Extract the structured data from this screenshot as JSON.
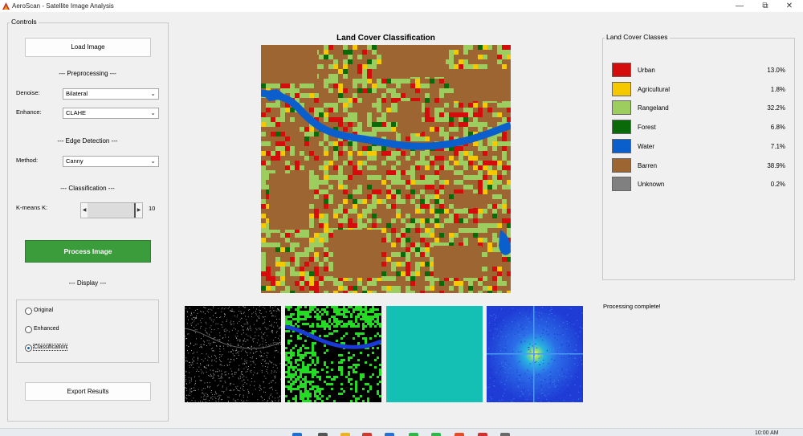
{
  "window": {
    "title": "AeroScan - Satellite Image Analysis",
    "minimize_glyph": "—",
    "maximize_glyph": "⧉",
    "close_glyph": "✕"
  },
  "controls": {
    "title": "Controls",
    "load_label": "Load Image",
    "preprocessing_label": "--- Preprocessing ---",
    "denoise_label": "Denoise:",
    "denoise_value": "Bilateral",
    "enhance_label": "Enhance:",
    "enhance_value": "CLAHE",
    "edge_label": "--- Edge Detection ---",
    "method_label": "Method:",
    "method_value": "Canny",
    "classification_label": "--- Classification ---",
    "kmeans_label": "K-means K:",
    "kmeans_value": "10",
    "kmeans_max": 10,
    "process_label": "Process Image",
    "display_label": "--- Display ---",
    "display_options": [
      "Original",
      "Enhanced",
      "Classification"
    ],
    "display_selected": "Classification",
    "export_label": "Export Results"
  },
  "map": {
    "title": "Land Cover Classification"
  },
  "legend": {
    "title": "Land Cover Classes",
    "classes": [
      {
        "name": "Urban",
        "pct": "13.0%",
        "color": "#d40c0c"
      },
      {
        "name": "Agricultural",
        "pct": "1.8%",
        "color": "#f5c800"
      },
      {
        "name": "Rangeland",
        "pct": "32.2%",
        "color": "#9dcc5f"
      },
      {
        "name": "Forest",
        "pct": "6.8%",
        "color": "#0a6a0a"
      },
      {
        "name": "Water",
        "pct": "7.1%",
        "color": "#0a5fcc"
      },
      {
        "name": "Barren",
        "pct": "38.9%",
        "color": "#9c6531"
      },
      {
        "name": "Unknown",
        "pct": "0.2%",
        "color": "#808080"
      }
    ]
  },
  "status": "Processing complete!",
  "clock": "10:00 AM"
}
